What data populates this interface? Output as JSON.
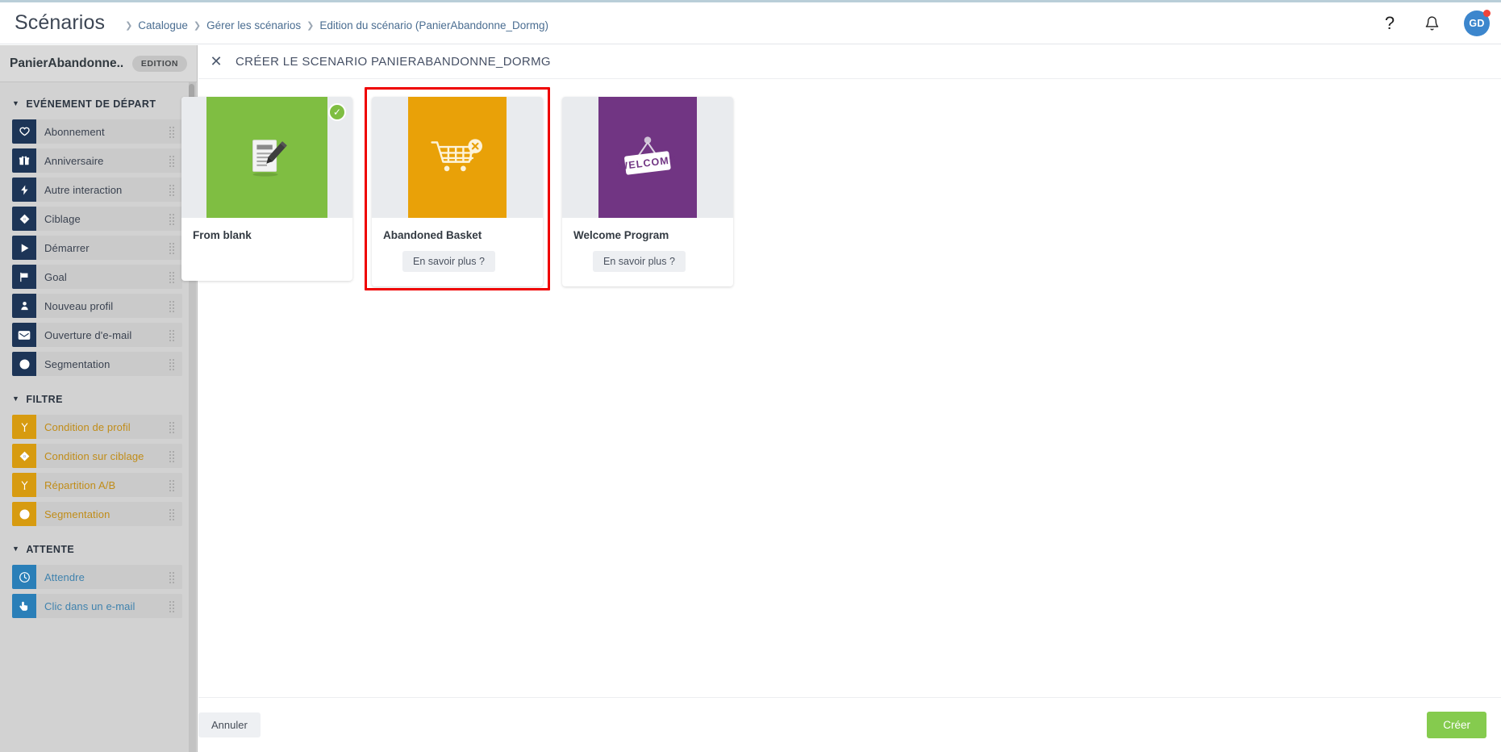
{
  "header": {
    "title": "Scénarios",
    "breadcrumb": [
      "Catalogue",
      "Gérer les scénarios",
      "Edition du scénario (PanierAbandonne_Dormg)"
    ],
    "help_icon": "question-mark-icon",
    "bell_icon": "bell-icon",
    "avatar_initials": "GD",
    "notification_dot": true
  },
  "sidebar": {
    "title": "PanierAbandonne...",
    "badge": "EDITION",
    "groups": [
      {
        "label": "EVÉNEMENT DE DÉPART",
        "category": "start",
        "items": [
          {
            "label": "Abonnement",
            "icon": "heart-icon"
          },
          {
            "label": "Anniversaire",
            "icon": "gift-icon"
          },
          {
            "label": "Autre interaction",
            "icon": "bolt-icon"
          },
          {
            "label": "Ciblage",
            "icon": "target-diamond-icon"
          },
          {
            "label": "Démarrer",
            "icon": "play-icon"
          },
          {
            "label": "Goal",
            "icon": "flag-icon"
          },
          {
            "label": "Nouveau profil",
            "icon": "user-icon"
          },
          {
            "label": "Ouverture d'e-mail",
            "icon": "envelope-open-icon"
          },
          {
            "label": "Segmentation",
            "icon": "pie-chart-icon"
          }
        ]
      },
      {
        "label": "FILTRE",
        "category": "filter",
        "items": [
          {
            "label": "Condition de profil",
            "icon": "branch-icon"
          },
          {
            "label": "Condition sur ciblage",
            "icon": "target-diamond-icon"
          },
          {
            "label": "Répartition A/B",
            "icon": "branch-icon"
          },
          {
            "label": "Segmentation",
            "icon": "pie-chart-icon"
          }
        ]
      },
      {
        "label": "ATTENTE",
        "category": "wait",
        "items": [
          {
            "label": "Attendre",
            "icon": "clock-icon"
          },
          {
            "label": "Clic dans un e-mail",
            "icon": "hand-pointer-icon"
          }
        ]
      }
    ]
  },
  "main": {
    "close_icon": "close-icon",
    "title": "CRÉER LE SCENARIO PANIERABANDONNE_DORMG",
    "cards": [
      {
        "name": "From blank",
        "icon": "document-pencil-icon",
        "thumb_color": "#7fbe42",
        "selected": true,
        "learn_more": null
      },
      {
        "name": "Abandoned Basket",
        "icon": "abandoned-cart-icon",
        "thumb_color": "#e9a108",
        "selected": false,
        "highlighted": true,
        "learn_more": "En savoir plus ?"
      },
      {
        "name": "Welcome Program",
        "icon": "welcome-sign-icon",
        "thumb_color": "#713583",
        "selected": false,
        "learn_more": "En savoir plus ?"
      }
    ]
  },
  "footer": {
    "cancel_label": "Annuler",
    "create_label": "Créer"
  },
  "colors": {
    "accent_green": "#85cb4e",
    "highlight_red": "#ef0000",
    "start_navy": "#1d3557",
    "filter_gold": "#d79b10",
    "wait_blue": "#2a7fb8",
    "avatar_blue": "#3c86cd"
  }
}
